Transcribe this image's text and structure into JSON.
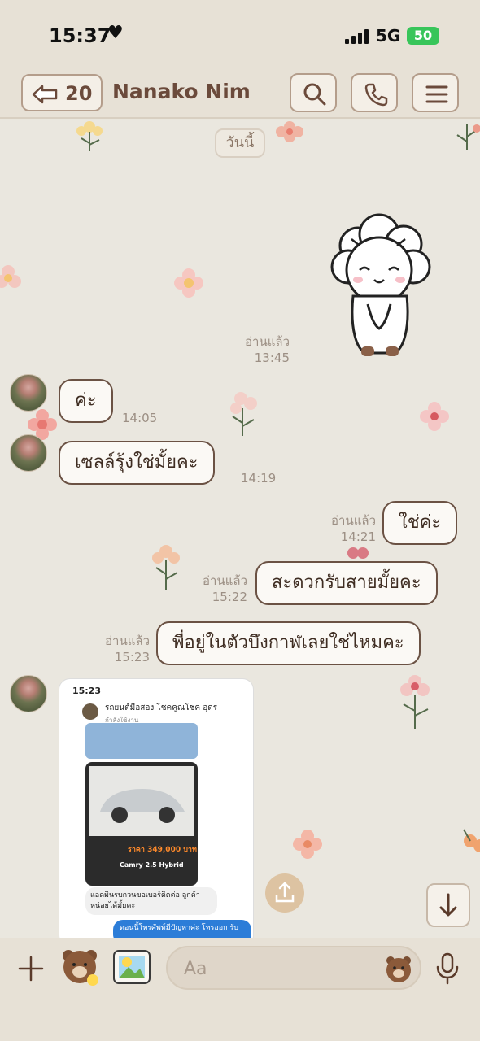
{
  "status": {
    "time": "15:37",
    "network": "5G",
    "battery": "50"
  },
  "header": {
    "back_count": "20",
    "title": "Nanako Nim"
  },
  "chat": {
    "date_chip": "วันนี้",
    "messages": [
      {
        "side": "right",
        "type": "sticker",
        "status": "อ่านแล้ว",
        "time": "13:45"
      },
      {
        "side": "left",
        "text": "ค่ะ",
        "time": "14:05"
      },
      {
        "side": "left",
        "text": "เซลล์รุ้งใช่มั้ยคะ",
        "time": "14:19"
      },
      {
        "side": "right",
        "text": "ใช่ค่ะ",
        "status": "อ่านแล้ว",
        "time": "14:21"
      },
      {
        "side": "right",
        "text": "สะดวกรับสายมั้ยคะ",
        "status": "อ่านแล้ว",
        "time": "15:22"
      },
      {
        "side": "right",
        "text": "พี่อยู่ในตัวบึงกาฬเลยใช่ไหมคะ",
        "status": "อ่านแล้ว",
        "time": "15:23"
      },
      {
        "side": "left",
        "type": "image"
      }
    ]
  },
  "screenshot": {
    "time": "15:23",
    "title": "รถยนต์มือสอง โชคคูณโชค อุดร",
    "subtitle": "กำลังใช้งาน",
    "price": "ราคา 349,000 บาท",
    "model": "Camry 2.5 Hybrid",
    "gray_message": "แอดมินรบกวนขอเบอร์ติดต่อ ลูกค้าหน่อยได้มั้ยคะ",
    "blue_message": "ตอนนี้โทรศัพท์มีปัญหาค่ะ โทรออก รับ"
  },
  "input": {
    "placeholder": "Aa"
  },
  "icons": [
    "heart-icon",
    "signal-icon",
    "battery-icon",
    "back-arrow-icon",
    "search-icon",
    "phone-icon",
    "menu-icon",
    "plus-icon",
    "bear-sticker-icon",
    "photo-sticker-icon",
    "upload-icon",
    "arrow-down-icon",
    "bear-emoji-icon",
    "microphone-icon"
  ]
}
